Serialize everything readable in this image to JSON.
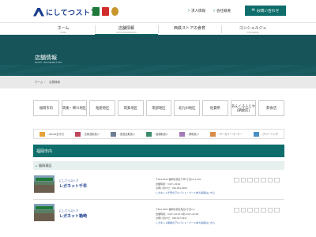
{
  "header": {
    "logo_text": "にしてつストア",
    "links": [
      "求人情報",
      "会社概要"
    ],
    "contact_label": "お問い合わせ",
    "brand_icons": [
      "green-brand-icon",
      "sp-brand-icon",
      "orange-brand-icon"
    ]
  },
  "nav": [
    {
      "label": "ホーム",
      "sub": "HOME"
    },
    {
      "label": "店舗情報",
      "sub": "SHOP INFORMATION"
    },
    {
      "label": "西鉄ストアの食育",
      "sub": ""
    },
    {
      "label": "コンシェルジュ",
      "sub": "CONCIERGE"
    },
    {
      "label": "",
      "sub": ""
    }
  ],
  "hero": {
    "title": "店舗情報",
    "subtitle": "SHOP INFORMATION"
  },
  "breadcrumb": [
    "ホーム",
    "店舗情報"
  ],
  "areas": [
    "福岡市内",
    "筑後・柳川地区",
    "粕屋地区",
    "筑紫地区",
    "南部地区",
    "北九州地区",
    "佐賀県",
    "あんくるふじや (朝倉店)",
    "飲食店"
  ],
  "legend": [
    "…ninoxe全平日",
    "…生鮮品取扱い",
    "…農産品取扱い",
    "…酒類取扱い",
    "…薬取扱い",
    "…ベーカリーコーナー",
    "…クリーニング"
  ],
  "section_title": "福岡市内",
  "sub_area": "福岡東区",
  "stores": [
    {
      "brand": "にしてつストア",
      "name": "レガネット千早",
      "lines": [
        "〒813-0044 福岡市東区千早4丁目13-1-101",
        "営業時間：9:00～23:00",
        "お問い合わせ：092-681-0200",
        "レガネット千早のアルバイト・パート求人情報はこちら"
      ]
    },
    {
      "brand": "にしてつストア",
      "name": "レガネット箱崎",
      "lines": [
        "〒812-0054 福岡市東区馬出3丁目1-1",
        "営業時間：9:00～22:00 1階 9:30～22:00",
        "お問い合わせ：092-627-0311",
        "レガネット箱崎のアルバイト・パート求人情報はこちら"
      ]
    }
  ],
  "colors": {
    "primary": "#0f6e6b",
    "hero_bg": "#16545a",
    "brand_blue": "#1a3d8f"
  }
}
